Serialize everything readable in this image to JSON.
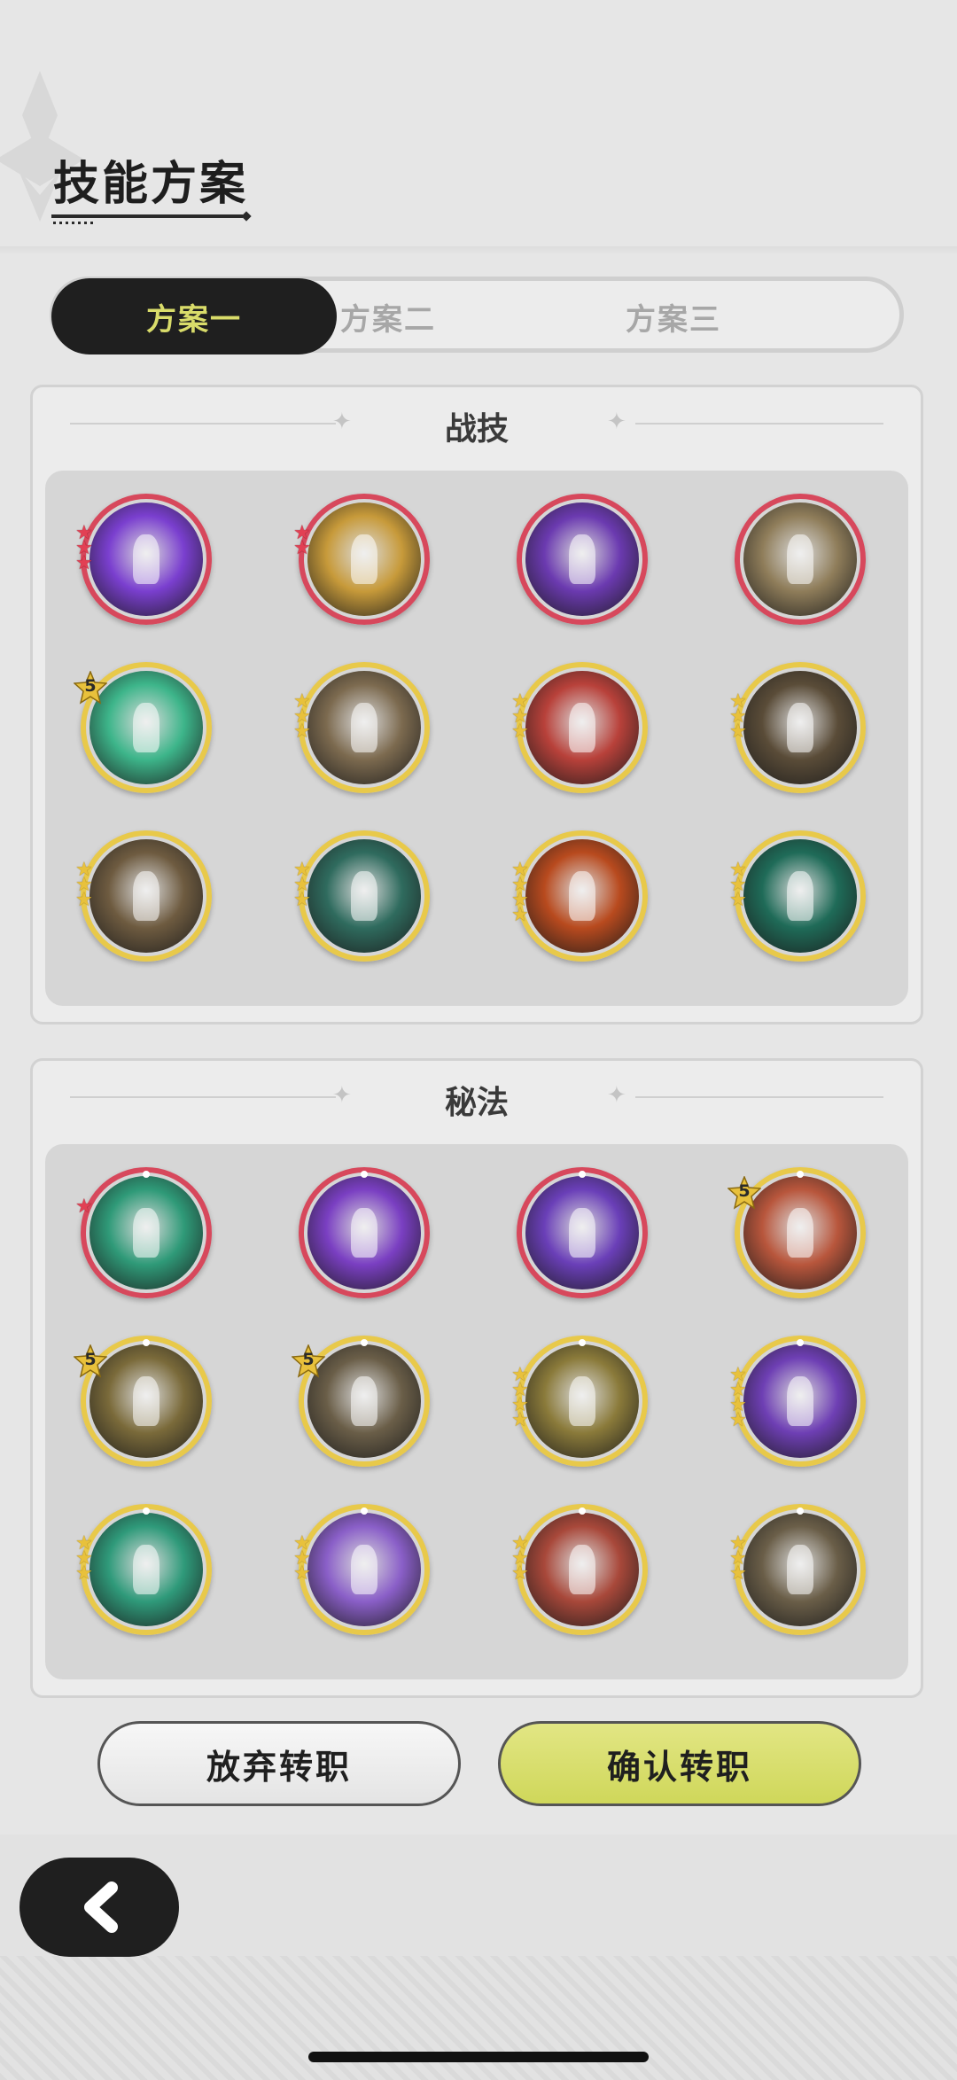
{
  "header": {
    "title": "技能方案"
  },
  "tabs": [
    {
      "label": "方案一",
      "active": true
    },
    {
      "label": "方案二",
      "active": false
    },
    {
      "label": "方案三",
      "active": false
    }
  ],
  "sections": {
    "combat": {
      "title": "战技",
      "skills": [
        {
          "icon": "purple-heart-burst-skill-icon",
          "rarity": "red",
          "stars": 3,
          "bg": "#7a3fcf"
        },
        {
          "icon": "golden-slash-skill-icon",
          "rarity": "red",
          "stars": 2,
          "bg": "#c79a3a"
        },
        {
          "icon": "purple-claw-skill-icon",
          "rarity": "red",
          "stars": 0,
          "bg": "#6b3ab0"
        },
        {
          "icon": "grasping-hand-skill-icon",
          "rarity": "red",
          "stars": 0,
          "bg": "#8f7d5a"
        },
        {
          "icon": "green-rising-arrows-skill-icon",
          "rarity": "gold",
          "level": "5",
          "bg": "#3db58a"
        },
        {
          "icon": "stone-spikes-skill-icon",
          "rarity": "gold",
          "stars": 3,
          "bg": "#7c6a4f"
        },
        {
          "icon": "red-sword-raise-skill-icon",
          "rarity": "gold",
          "stars": 3,
          "bg": "#b8413a"
        },
        {
          "icon": "crescent-blade-skill-icon",
          "rarity": "gold",
          "stars": 3,
          "bg": "#5a4c38"
        },
        {
          "icon": "dust-strike-skill-icon",
          "rarity": "gold",
          "stars": 3,
          "bg": "#6e5b40"
        },
        {
          "icon": "web-net-skill-icon",
          "rarity": "gold",
          "stars": 3,
          "bg": "#2f6b5e"
        },
        {
          "icon": "fire-arc-skill-icon",
          "rarity": "gold",
          "stars": 4,
          "bg": "#b84a1e"
        },
        {
          "icon": "green-greatsword-skill-icon",
          "rarity": "gold",
          "stars": 3,
          "bg": "#1f6b58"
        }
      ]
    },
    "arcane": {
      "title": "秘法",
      "skills": [
        {
          "icon": "heal-plus-skill-icon",
          "rarity": "red",
          "stars": 1,
          "bg": "#2f9a78"
        },
        {
          "icon": "purple-flame-skill-icon",
          "rarity": "red",
          "stars": 0,
          "bg": "#7a3fc2"
        },
        {
          "icon": "figure-aura-skill-icon",
          "rarity": "red",
          "stars": 0,
          "bg": "#6a3fb8"
        },
        {
          "icon": "red-beast-skill-icon",
          "rarity": "gold",
          "level": "5",
          "bg": "#b8563c"
        },
        {
          "icon": "golem-skill-icon",
          "rarity": "gold",
          "level": "5",
          "bg": "#7a6a3a"
        },
        {
          "icon": "maple-leaf-skill-icon",
          "rarity": "gold",
          "level": "5",
          "bg": "#6a5e48"
        },
        {
          "icon": "all-seeing-eye-skill-icon",
          "rarity": "gold",
          "stars": 4,
          "bg": "#8a7a3a"
        },
        {
          "icon": "purple-wolf-skill-icon",
          "rarity": "gold",
          "stars": 4,
          "bg": "#6e3fb4"
        },
        {
          "icon": "green-dagger-skill-icon",
          "rarity": "gold",
          "stars": 3,
          "bg": "#2f9a7a"
        },
        {
          "icon": "purple-mind-skill-icon",
          "rarity": "gold",
          "stars": 3,
          "bg": "#8a5fc8"
        },
        {
          "icon": "red-armor-skill-icon",
          "rarity": "gold",
          "stars": 3,
          "bg": "#a8483a"
        },
        {
          "icon": "beast-head-skill-icon",
          "rarity": "gold",
          "stars": 3,
          "bg": "#6a5e48"
        }
      ]
    }
  },
  "buttons": {
    "quit": "放弃转职",
    "confirm": "确认转职"
  },
  "nav": {
    "back_icon": "chevron-left-icon"
  }
}
